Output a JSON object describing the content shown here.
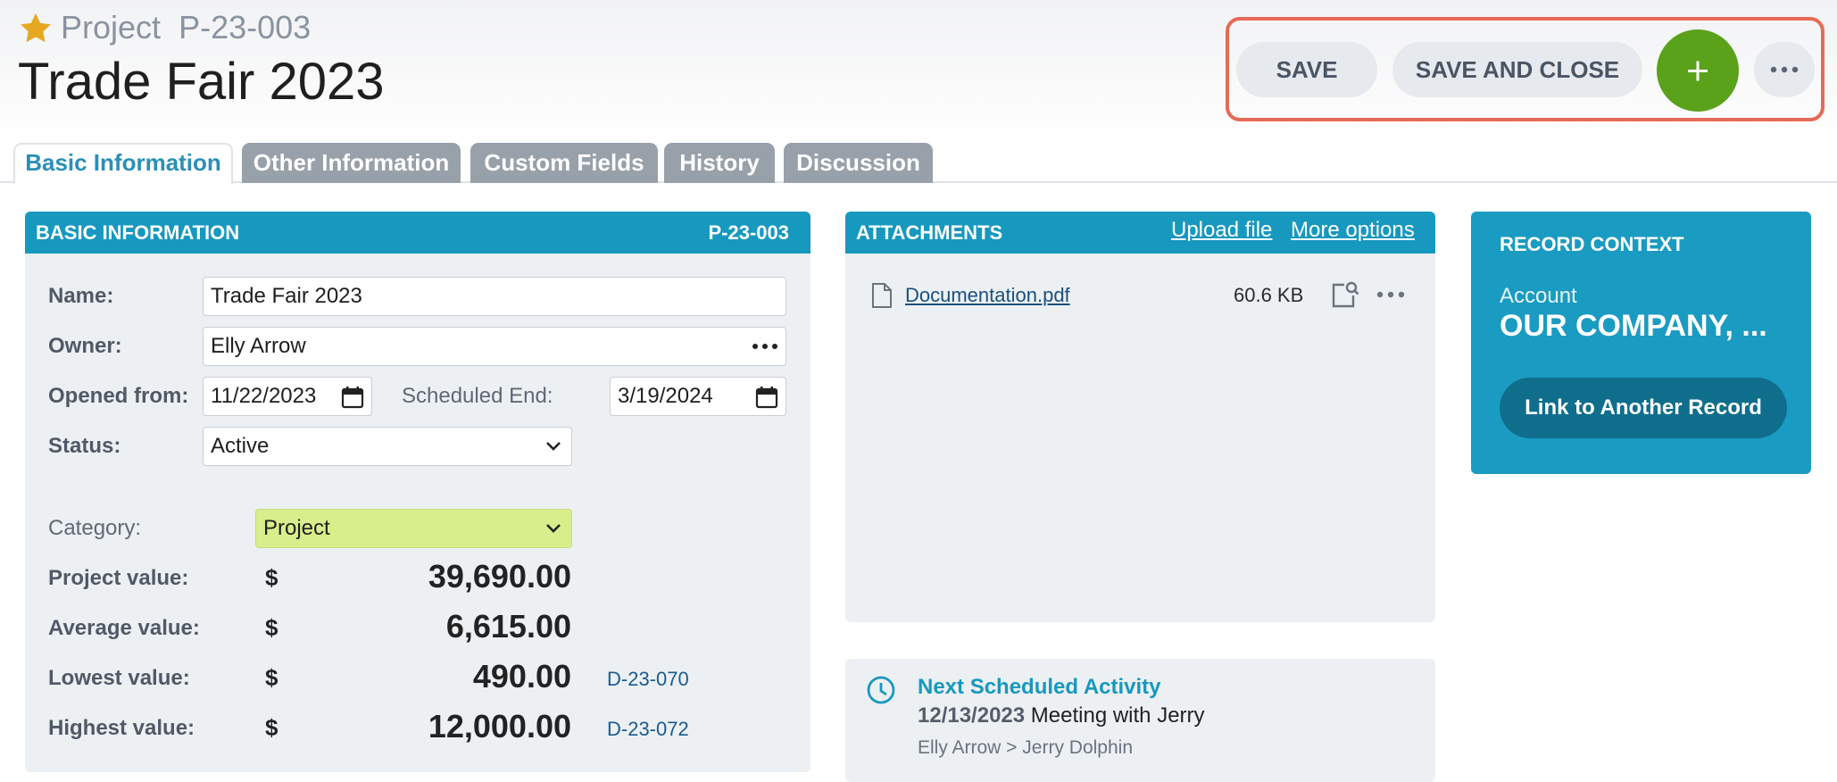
{
  "header": {
    "record_type": "Project",
    "record_id": "P-23-003",
    "title": "Trade Fair 2023"
  },
  "toolbar": {
    "save_label": "SAVE",
    "save_close_label": "SAVE AND CLOSE",
    "add_icon": "plus-icon",
    "more_icon": "ellipsis-icon"
  },
  "tabs": [
    {
      "label": "Basic Information",
      "active": true
    },
    {
      "label": "Other Information"
    },
    {
      "label": "Custom Fields"
    },
    {
      "label": "History"
    },
    {
      "label": "Discussion"
    }
  ],
  "basic_info": {
    "title": "BASIC INFORMATION",
    "record_id": "P-23-003",
    "name_label": "Name:",
    "name_value": "Trade Fair 2023",
    "owner_label": "Owner:",
    "owner_value": "Elly Arrow",
    "opened_label": "Opened from:",
    "opened_value": "11/22/2023",
    "sched_end_label": "Scheduled End:",
    "sched_end_value": "3/19/2024",
    "status_label": "Status:",
    "status_value": "Active",
    "category_label": "Category:",
    "category_value": "Project",
    "values": [
      {
        "label": "Project value:",
        "currency": "$",
        "amount": "39,690.00",
        "ref": ""
      },
      {
        "label": "Average value:",
        "currency": "$",
        "amount": "6,615.00",
        "ref": ""
      },
      {
        "label": "Lowest value:",
        "currency": "$",
        "amount": "490.00",
        "ref": "D-23-070"
      },
      {
        "label": "Highest value:",
        "currency": "$",
        "amount": "12,000.00",
        "ref": "D-23-072"
      }
    ]
  },
  "attachments": {
    "title": "ATTACHMENTS",
    "upload_link": "Upload file",
    "more_link": "More options",
    "files": [
      {
        "name": "Documentation.pdf",
        "size": "60.6 KB"
      }
    ]
  },
  "activity": {
    "title": "Next Scheduled Activity",
    "date": "12/13/2023",
    "subject": "Meeting with Jerry",
    "people": "Elly Arrow > Jerry Dolphin"
  },
  "record_context": {
    "title": "RECORD CONTEXT",
    "account_label": "Account",
    "account_value": "OUR COMPANY, ...",
    "link_button": "Link to Another Record"
  },
  "colors": {
    "accent": "#1798bf",
    "add_button": "#5aa21a",
    "category_highlight": "#d8ee8c",
    "toolbar_highlight": "#e66a57"
  }
}
